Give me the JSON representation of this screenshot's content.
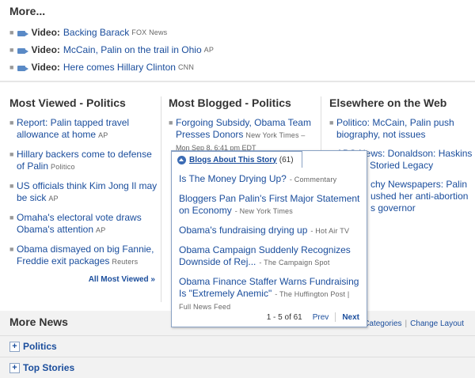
{
  "more": {
    "title": "More...",
    "items": [
      {
        "label": "Video:",
        "text": "Backing Barack",
        "source": "FOX News"
      },
      {
        "label": "Video:",
        "text": "McCain, Palin on the trail in Ohio",
        "source": "AP"
      },
      {
        "label": "Video:",
        "text": "Here comes Hillary Clinton",
        "source": "CNN"
      }
    ],
    "icon": "video-camera-icon"
  },
  "most_viewed": {
    "title": "Most Viewed - Politics",
    "items": [
      {
        "text": "Report: Palin tapped travel allowance at home",
        "source": "AP"
      },
      {
        "text": "Hillary backers come to defense of Palin",
        "source": "Politico"
      },
      {
        "text": "US officials think Kim Jong Il may be sick",
        "source": "AP"
      },
      {
        "text": "Omaha's electoral vote draws Obama's attention",
        "source": "AP"
      },
      {
        "text": "Obama dismayed on big Fannie, Freddie exit packages",
        "source": "Reuters"
      }
    ],
    "all_link": "All Most Viewed »"
  },
  "most_blogged": {
    "title": "Most Blogged - Politics",
    "items": [
      {
        "text": "Forgoing Subsidy, Obama Team Presses Donors",
        "source": "New York Times",
        "time": "Mon Sep 8, 6:41 pm EDT"
      }
    ]
  },
  "elsewhere": {
    "title": "Elsewhere on the Web",
    "items": [
      {
        "text": "Politico: McCain, Palin push biography, not issues"
      },
      {
        "text": "ABC News: Donaldson: Haskins Leaves Storied Legacy"
      },
      {
        "prefix": "chy Newspapers: Palin",
        "text": "ushed her anti-abortion",
        "suffix": "s governor"
      }
    ]
  },
  "popup": {
    "tab_title": "Blogs About This Story",
    "count": "(61)",
    "items": [
      {
        "text": "Is The Money Drying Up?",
        "source": "Commentary"
      },
      {
        "text": "Bloggers Pan Palin's First Major Statement on Economy",
        "source": "New York Times"
      },
      {
        "text": "Obama's fundraising drying up",
        "source": "Hot Air TV"
      },
      {
        "text": "Obama Campaign Suddenly Recognizes Downside of Rej...",
        "source": "The Campaign Spot"
      },
      {
        "text": "Obama Finance Staffer Warns Fundraising Is \"Extremely Anemic\"",
        "source": "The Huffington Post | Full News Feed"
      }
    ],
    "range": "1 - 5 of 61",
    "prev": "Prev",
    "next": "Next"
  },
  "more_news": {
    "title": "More News",
    "links": [
      "Categories",
      "Change Layout"
    ],
    "sections": [
      "Politics",
      "Top Stories"
    ]
  }
}
